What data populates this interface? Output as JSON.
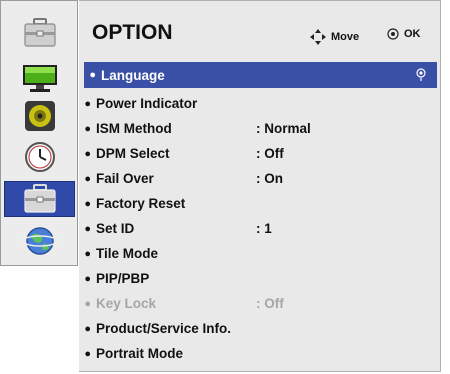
{
  "header": {
    "title": "OPTION",
    "move_label": "Move",
    "ok_label": "OK"
  },
  "sidebar": {
    "items": [
      {
        "icon": "option-briefcase-icon",
        "selected": false
      },
      {
        "icon": "picture-monitor-icon",
        "selected": false
      },
      {
        "icon": "audio-speaker-icon",
        "selected": false
      },
      {
        "icon": "time-clock-icon",
        "selected": false
      },
      {
        "icon": "option-briefcase-icon",
        "selected": true
      },
      {
        "icon": "network-globe-icon",
        "selected": false
      }
    ]
  },
  "menu": {
    "items": [
      {
        "label": "Language",
        "value": "",
        "selected": true,
        "disabled": false
      },
      {
        "label": "Power Indicator",
        "value": "",
        "selected": false,
        "disabled": false
      },
      {
        "label": "ISM Method",
        "value": ": Normal",
        "selected": false,
        "disabled": false
      },
      {
        "label": "DPM Select",
        "value": ": Off",
        "selected": false,
        "disabled": false
      },
      {
        "label": "Fail Over",
        "value": ": On",
        "selected": false,
        "disabled": false
      },
      {
        "label": "Factory Reset",
        "value": "",
        "selected": false,
        "disabled": false
      },
      {
        "label": "Set ID",
        "value": ": 1",
        "selected": false,
        "disabled": false
      },
      {
        "label": "Tile Mode",
        "value": "",
        "selected": false,
        "disabled": false
      },
      {
        "label": "PIP/PBP",
        "value": "",
        "selected": false,
        "disabled": false
      },
      {
        "label": "Key Lock",
        "value": ": Off",
        "selected": false,
        "disabled": true
      },
      {
        "label": "Product/Service Info.",
        "value": "",
        "selected": false,
        "disabled": false
      },
      {
        "label": "Portrait Mode",
        "value": "",
        "selected": false,
        "disabled": false
      }
    ]
  },
  "colors": {
    "selected_row": "#3a4fa6",
    "selected_sidebar": "#2f4aa8",
    "disabled_text": "#a6a6a6"
  }
}
